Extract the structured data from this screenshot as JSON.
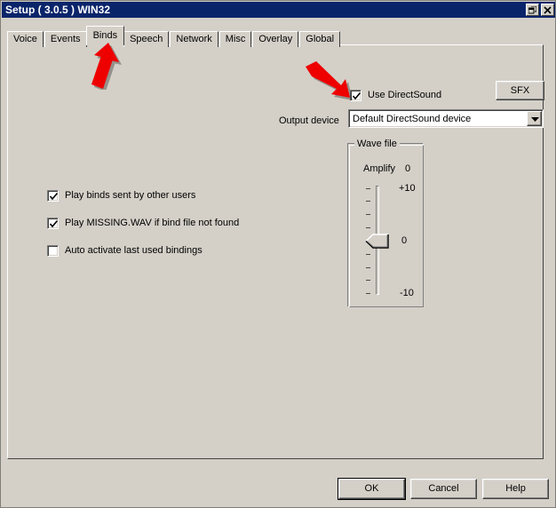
{
  "window": {
    "title": "Setup ( 3.0.5 ) WIN32",
    "titlebar_color": "#0a246a",
    "face_color": "#d4d0c8",
    "restore_button_name": "restore",
    "close_button_name": "close"
  },
  "tabs": [
    {
      "label": "Voice",
      "selected": false
    },
    {
      "label": "Events",
      "selected": false
    },
    {
      "label": "Binds",
      "selected": true
    },
    {
      "label": "Speech",
      "selected": false
    },
    {
      "label": "Network",
      "selected": false
    },
    {
      "label": "Misc",
      "selected": false
    },
    {
      "label": "Overlay",
      "selected": false
    },
    {
      "label": "Global",
      "selected": false
    }
  ],
  "binds_page": {
    "use_directsound": {
      "label": "Use DirectSound",
      "checked": true
    },
    "sfx_button": {
      "label": "SFX"
    },
    "output_device": {
      "label": "Output device",
      "value": "Default DirectSound device",
      "arrow_icon": "chevron-down-icon"
    },
    "options": [
      {
        "label": "Play binds sent by other users",
        "checked": true
      },
      {
        "label": "Play MISSING.WAV if bind file not found",
        "checked": true
      },
      {
        "label": "Auto activate last used bindings",
        "checked": false
      }
    ],
    "wave_file": {
      "title": "Wave file",
      "amplify_label": "Amplify",
      "amplify_value": "0",
      "scale_top": "+10",
      "scale_mid": "0",
      "scale_bottom": "-10",
      "tick_count": 9,
      "slider_value": 0
    }
  },
  "footer": {
    "ok": "OK",
    "cancel": "Cancel",
    "help": "Help"
  },
  "annotations": {
    "arrow_color": "#ee0000",
    "arrow_to_binds_tab": "arrow-pointing-to-binds-tab",
    "arrow_to_use_directsound": "arrow-pointing-to-use-directsound-checkbox"
  }
}
